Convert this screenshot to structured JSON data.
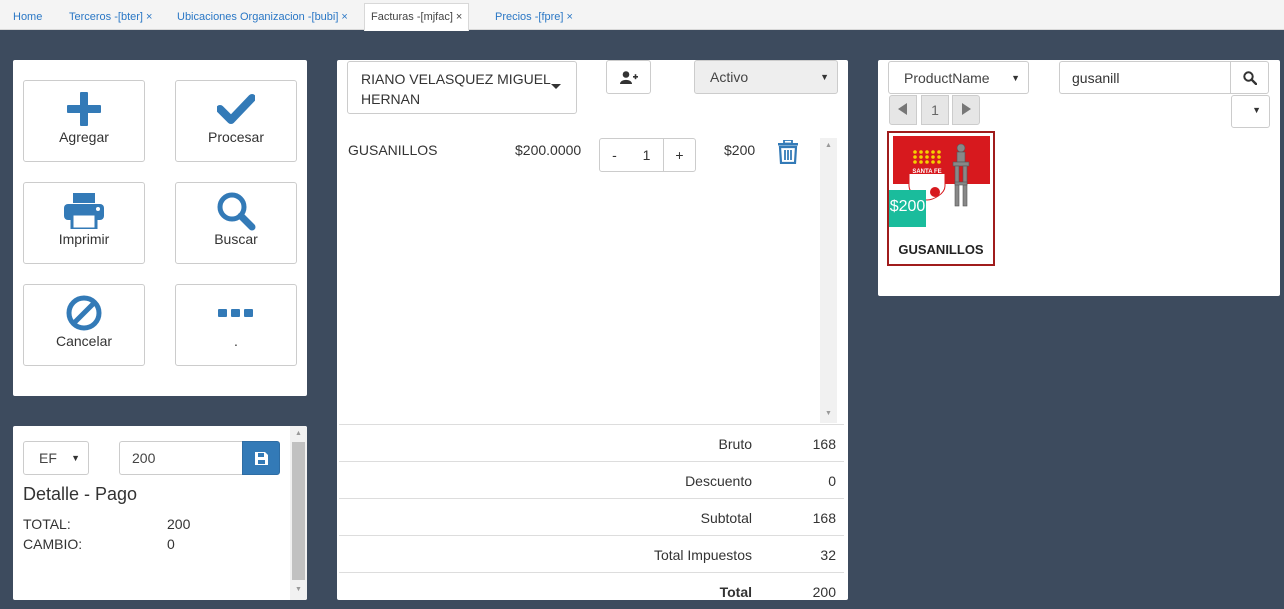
{
  "tabs": [
    {
      "label": "Home",
      "closable": false
    },
    {
      "label": "Terceros -[bter]",
      "closable": true
    },
    {
      "label": "Ubicaciones Organizacion -[bubi]",
      "closable": true
    },
    {
      "label": "Facturas -[mjfac]",
      "closable": true,
      "active": true
    },
    {
      "label": "Precios -[fpre]",
      "closable": true
    }
  ],
  "tab_close_glyph": "×",
  "actions": [
    {
      "label": "Agregar",
      "icon": "plus-icon"
    },
    {
      "label": "Procesar",
      "icon": "check-icon"
    },
    {
      "label": "Imprimir",
      "icon": "print-icon"
    },
    {
      "label": "Buscar",
      "icon": "search-icon"
    },
    {
      "label": "Cancelar",
      "icon": "ban-icon"
    },
    {
      "label": ".",
      "icon": "ellipsis-icon"
    }
  ],
  "payment": {
    "method": "EF",
    "amount_value": "200",
    "title": "Detalle - Pago",
    "total_label": "TOTAL:",
    "total_value": "200",
    "change_label": "CAMBIO:",
    "change_value": "0"
  },
  "invoice": {
    "customer_line1": "RIANO VELASQUEZ MIGUEL",
    "customer_line2": "HERNAN",
    "status": "Activo",
    "lines": [
      {
        "product": "GUSANILLOS",
        "unit_price": "$200.0000",
        "qty": "1",
        "line_total": "$200"
      }
    ],
    "minus_label": "-",
    "plus_label": "+",
    "totals": [
      {
        "label": "Bruto",
        "value": "168"
      },
      {
        "label": "Descuento",
        "value": "0"
      },
      {
        "label": "Subtotal",
        "value": "168"
      },
      {
        "label": "Total Impuestos",
        "value": "32"
      },
      {
        "label": "Total",
        "value": "200"
      }
    ]
  },
  "catalog": {
    "sort_field": "ProductName",
    "search_value": "gusanill",
    "page": "1",
    "products": [
      {
        "name": "GUSANILLOS",
        "price": "$200",
        "logo_text": "SANTA FE"
      }
    ]
  },
  "colors": {
    "accent": "#337ab7",
    "background": "#3d4b5e",
    "price_badge": "#1abc9c",
    "product_border": "#a01c1c",
    "logo_red": "#d7191e"
  }
}
